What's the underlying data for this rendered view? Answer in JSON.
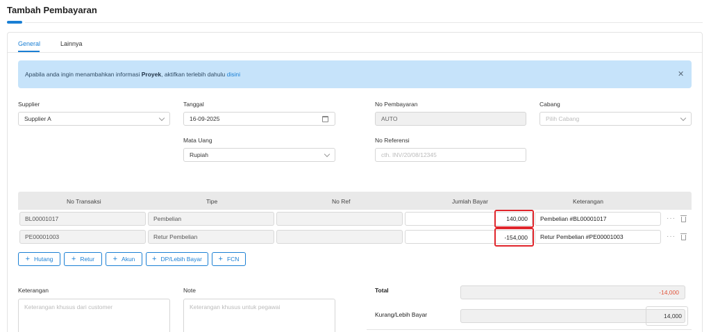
{
  "page": {
    "title": "Tambah Pembayaran"
  },
  "tabs": [
    {
      "label": "General",
      "active": true
    },
    {
      "label": "Lainnya",
      "active": false
    }
  ],
  "alert": {
    "text_before": "Apabila anda ingin menambahkan informasi ",
    "bold": "Proyek",
    "text_after": ", aktifkan terlebih dahulu ",
    "link": "disini",
    "close_icon": "close-icon"
  },
  "form": {
    "supplier": {
      "label": "Supplier",
      "value": "Supplier A"
    },
    "tanggal": {
      "label": "Tanggal",
      "value": "16-09-2025"
    },
    "no_pembayaran": {
      "label": "No Pembayaran",
      "value": "AUTO"
    },
    "cabang": {
      "label": "Cabang",
      "placeholder": "Pilih Cabang"
    },
    "mata_uang": {
      "label": "Mata Uang",
      "value": "Rupiah"
    },
    "no_referensi": {
      "label": "No Referensi",
      "placeholder": "cth. INV/20/08/12345"
    }
  },
  "table": {
    "headers": [
      "No Transaksi",
      "Tipe",
      "No Ref",
      "Jumlah Bayar",
      "Keterangan"
    ],
    "rows": [
      {
        "no_transaksi": "BL00001017",
        "tipe": "Pembelian",
        "no_ref": "",
        "jumlah": "140,000",
        "keterangan": "Pembelian #BL00001017"
      },
      {
        "no_transaksi": "PE00001003",
        "tipe": "Retur Pembelian",
        "no_ref": "",
        "jumlah": "-154,000",
        "keterangan": "Retur Pembelian #PE00001003"
      }
    ],
    "row_menu": "···"
  },
  "buttons": [
    {
      "label": "Hutang"
    },
    {
      "label": "Retur"
    },
    {
      "label": "Akun"
    },
    {
      "label": "DP/Lebih Bayar"
    },
    {
      "label": "FCN"
    }
  ],
  "bottom": {
    "keterangan": {
      "label": "Keterangan",
      "placeholder": "Keterangan khusus dari customer"
    },
    "note": {
      "label": "Note",
      "placeholder": "Keterangan khusus untuk pegawai"
    },
    "total": {
      "label": "Total",
      "value": "-14,000"
    },
    "kurang": {
      "label": "Kurang/Lebih Bayar",
      "value": "14,000"
    }
  },
  "colors": {
    "accent": "#1a7fd4",
    "alert_bg": "#c6e3fa",
    "highlight": "#e0252b",
    "negative": "#e0533a"
  }
}
